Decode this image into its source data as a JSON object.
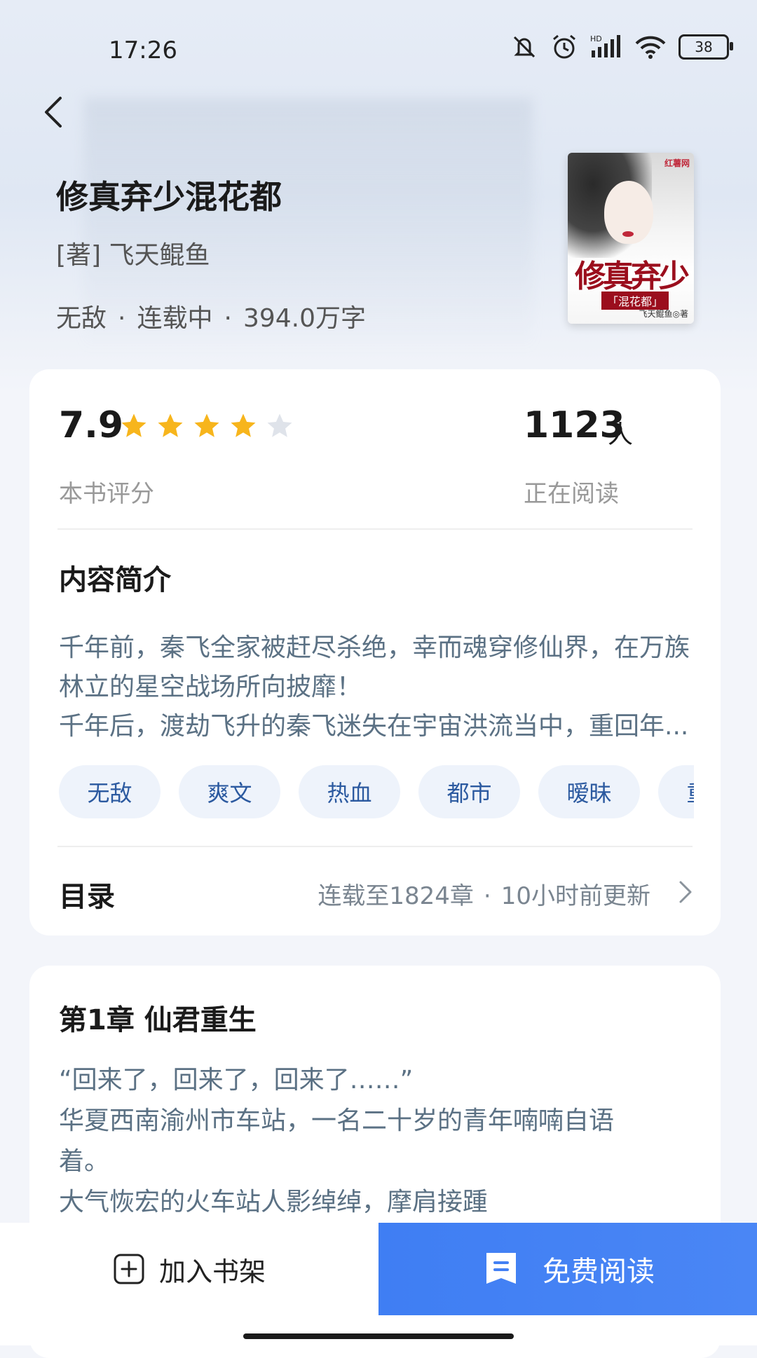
{
  "status_bar": {
    "time": "17:26",
    "battery": "38",
    "network": "HD"
  },
  "book": {
    "title": "修真弃少混花都",
    "author": "[著] 飞天鲲鱼",
    "genre": "无敌",
    "status": "连载中",
    "word_count": "394.0万字",
    "dot": "·",
    "cover": {
      "tag": "红薯网",
      "title": "修真弃少",
      "subtitle": "「混花都」",
      "author": "飞天鲲鱼◎著"
    }
  },
  "stats": {
    "rating": "7.9",
    "rating_label": "本书评分",
    "stars": {
      "filled": 4,
      "total": 5
    },
    "readers": "1123",
    "readers_unit": "人",
    "readers_label": "正在阅读"
  },
  "intro": {
    "heading": "内容简介",
    "lines": [
      "千年前，秦飞全家被赶尽杀绝，幸而魂穿修仙界，在万族",
      "林立的星空战场所向披靡！",
      "千年后，渡劫飞升的秦飞迷失在宇宙洪流当中，重回年..."
    ]
  },
  "tags": [
    "无敌",
    "爽文",
    "热血",
    "都市",
    "暧昧",
    "重生"
  ],
  "toc": {
    "label": "目录",
    "progress": "连载至1824章",
    "updated": "10小时前更新"
  },
  "chapter": {
    "title": "第1章 仙君重生",
    "lines": [
      "“回来了，回来了，回来了……”",
      "华夏西南渝州市车站，一名二十岁的青年喃喃自语",
      "着。",
      "大气恢宏的火车站人影绰绰，摩肩接踵"
    ]
  },
  "actions": {
    "add_shelf": "加入书架",
    "free_read": "免费阅读"
  },
  "colors": {
    "accent": "#4380f4",
    "tag_text": "#2c5aa0",
    "tag_bg": "#eef3fb",
    "star": "#f7b51c",
    "star_empty": "#dfe3ea"
  }
}
